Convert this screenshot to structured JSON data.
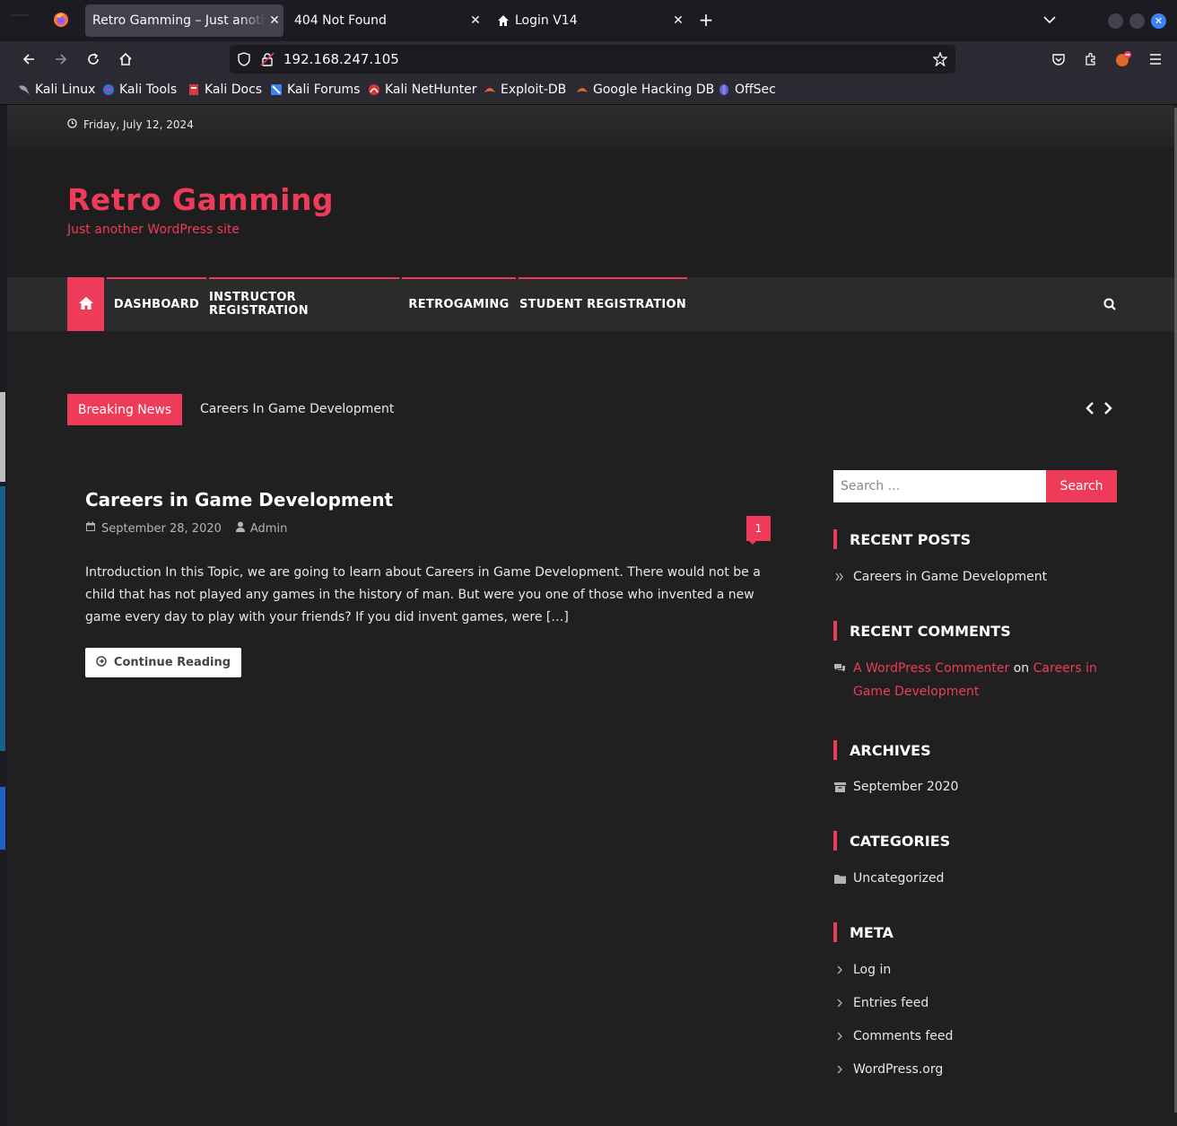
{
  "browser": {
    "tabs": [
      {
        "label": "Retro Gamming – Just another WordPress site",
        "active": true
      },
      {
        "label": "404 Not Found",
        "active": false
      },
      {
        "label": "Login V14",
        "active": false
      }
    ],
    "url": "192.168.247.105",
    "bookmarks": [
      "Kali Linux",
      "Kali Tools",
      "Kali Docs",
      "Kali Forums",
      "Kali NetHunter",
      "Exploit-DB",
      "Google Hacking DB",
      "OffSec"
    ]
  },
  "site": {
    "date": "Friday, July 12, 2024",
    "title": "Retro Gamming",
    "description": "Just another WordPress site",
    "accent_color": "#ef3b5a"
  },
  "menu": {
    "items": [
      "DASHBOARD",
      "INSTRUCTOR REGISTRATION",
      "RETROGAMING",
      "STUDENT REGISTRATION"
    ]
  },
  "breaking": {
    "label": "Breaking News",
    "headline": "Careers In Game Development"
  },
  "post": {
    "title": "Careers in Game Development",
    "date": "September 28, 2020",
    "author": "Admin",
    "comments": "1",
    "excerpt": "Introduction In this Topic, we are going to learn about Careers in Game Development. There would not be a child that has not played any games in the history of man. But were you one of those who invented a new game every day to play with your friends? If you did invent games, were […]",
    "continue_label": "Continue Reading"
  },
  "sidebar": {
    "search_placeholder": "Search …",
    "search_button": "Search",
    "recent_posts_title": "RECENT POSTS",
    "recent_posts": [
      "Careers in Game Development"
    ],
    "recent_comments_title": "RECENT COMMENTS",
    "comment_author": "A WordPress Commenter",
    "comment_on": "on",
    "comment_post_line1": "Careers in",
    "comment_post_line2": "Game Development",
    "archives_title": "ARCHIVES",
    "archives": [
      "September 2020"
    ],
    "categories_title": "CATEGORIES",
    "categories": [
      "Uncategorized"
    ],
    "meta_title": "META",
    "meta": [
      "Log in",
      "Entries feed",
      "Comments feed",
      "WordPress.org"
    ]
  }
}
